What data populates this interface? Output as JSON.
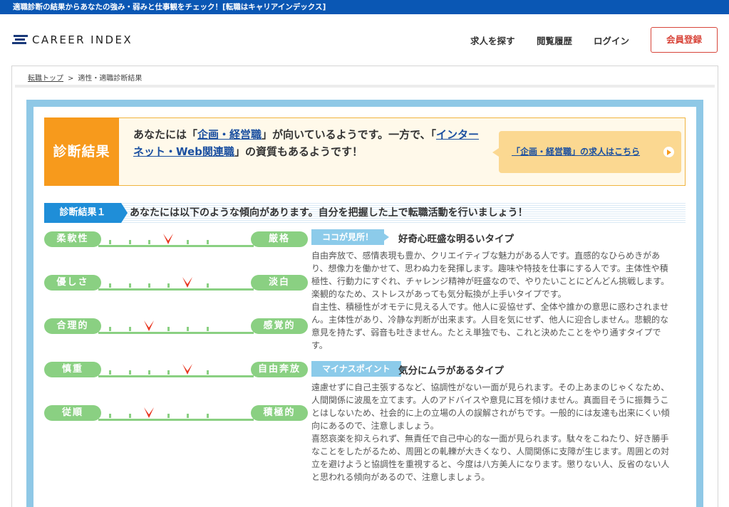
{
  "topbar": {
    "text": "適職診断の結果からあなたの強み・弱みと仕事観をチェック！[転職はキャリアインデックス]"
  },
  "header": {
    "logo_text": "CAREER INDEX",
    "nav": [
      "求人を探す",
      "閲覧履歴",
      "ログイン"
    ],
    "register_label": "会員登録"
  },
  "breadcrumb": {
    "home": "転職トップ",
    "separator": ">",
    "current": "適性・適職診断結果"
  },
  "result": {
    "label": "診断結果",
    "text_prefix": "あなたには「",
    "job1": "企画・経営職",
    "text_mid": "」が向いているようです。一方で、「",
    "job2": "インターネット・Web関連職",
    "text_suffix": "」の資質もあるようです！",
    "link_label": "「企画・経営職」の求人はこちら"
  },
  "section1": {
    "label": "診断結果１",
    "title": "あなたには以下のような傾向があります。自分を把握した上で転職活動を行いましょう！"
  },
  "scales": [
    {
      "left": "柔軟性",
      "right": "厳格",
      "level": 4,
      "of": 7
    },
    {
      "left": "優しさ",
      "right": "淡白",
      "level": 5,
      "of": 7
    },
    {
      "left": "合理的",
      "right": "感覚的",
      "level": 3,
      "of": 7
    },
    {
      "left": "慎重",
      "right": "自由奔放",
      "level": 5,
      "of": 7
    },
    {
      "left": "従順",
      "right": "積極的",
      "level": 3,
      "of": 7
    }
  ],
  "strength": {
    "badge": "ココが見所！",
    "title": "好奇心旺盛な明るいタイプ",
    "paragraphs": [
      "自由奔放で、感情表現も豊か、クリエイティブな魅力がある人です。直感的なひらめきがあり、想像力を働かせて、思わぬ力を発揮します。趣味や特技を仕事にする人です。主体性や積極性、行動力にすぐれ、チャレンジ精神が旺盛なので、やりたいことにどんどん挑戦します。楽観的なため、ストレスがあっても気分転換が上手いタイプです。",
      "自主性、積極性がオモテに見える人です。他人に妥協せず、全体や誰かの意思に惑わされません。主体性があり、冷静な判断が出来ます。人目を気にせず、他人に迎合しません。悲観的な意見を持たず、弱音も吐きません。たとえ単独でも、これと決めたことをやり通すタイプです。"
    ]
  },
  "weakness": {
    "badge": "マイナスポイント",
    "title": "気分にムラがあるタイプ",
    "paragraphs": [
      "遠慮せずに自己主張するなど、協調性がない一面が見られます。その上あまのじゃくなため、人間関係に波風を立てます。人のアドバイスや意見に耳を傾けません。真面目そうに振舞うことはしないため、社会的に上の立場の人の誤解されがちです。一般的には友達も出来にくい傾向にあるので、注意しましょう。",
      "喜怒哀楽を抑えられず、無責任で自己中心的な一面が見られます。駄々をこねたり、好き勝手なことをしたがるため、周囲との軋轢が大きくなり、人間関係に支障が生じます。周囲との対立を避けようと協調性を重視すると、今度は八方美人になります。懲りない人、反省のない人と思われる傾向があるので、注意しましょう。"
    ]
  },
  "colors": {
    "topbar": "#0a57b4",
    "accent_orange": "#f79a1c",
    "scale_green": "#8ad082",
    "marker_red": "#e8351f",
    "panel_blue": "#8fc8e6"
  }
}
